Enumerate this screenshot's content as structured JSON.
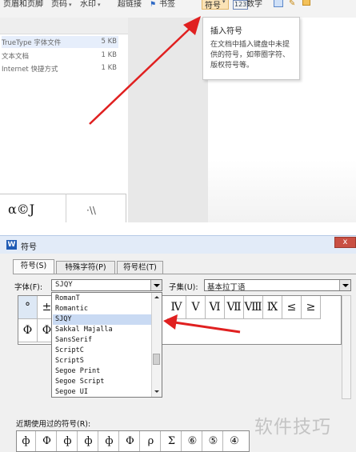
{
  "ribbon": {
    "items": [
      "页眉和页脚",
      "页码",
      "水印",
      "超链接",
      "书签"
    ],
    "symbol_button": "符号",
    "number_button": "数字"
  },
  "tooltip": {
    "title": "插入符号",
    "body": "在文档中插入键盘中未提供的符号，如带圈字符、版权符号等。"
  },
  "files": [
    {
      "name": "TrueType 字体文件",
      "size": "5 KB"
    },
    {
      "name": "文本文档",
      "size": "1 KB"
    },
    {
      "name": "Internet 快捷方式",
      "size": "1 KB"
    }
  ],
  "preview": {
    "glyph": "α©J",
    "glyph2": "·\\\\"
  },
  "dialog": {
    "title": "符号",
    "close": "x",
    "tabs": [
      "符号(S)",
      "特殊字符(P)",
      "符号栏(T)"
    ],
    "font_label": "字体(F):",
    "font_value": "SJQY",
    "subset_label": "子集(U):",
    "subset_value": "基本拉丁语",
    "font_options": [
      "RomanT",
      "Romantic",
      "SJQY",
      "Sakkal Majalla",
      "SansSerif",
      "ScriptC",
      "ScriptS",
      "Segoe Print",
      "Segoe Script",
      "Segoe UI"
    ],
    "selected_font": "SJQY",
    "grid_row1_visible": [
      "°",
      "±"
    ],
    "grid_row2_visible": [
      "Φ",
      "Φ"
    ],
    "grid_row1_right": [
      "Ⅳ",
      "Ⅴ",
      "Ⅵ",
      "Ⅶ",
      "Ⅷ",
      "Ⅸ",
      "≤",
      "≥"
    ],
    "recent_label": "近期使用过的符号(R):",
    "recent": [
      "ф",
      "Ф",
      "ф",
      "ф",
      "ф",
      "Φ",
      "ρ",
      "Σ",
      "⑥",
      "⑤",
      "④"
    ]
  },
  "watermark": "软件技巧",
  "colors": {
    "arrow": "#e02020",
    "accent": "#1f5bb5",
    "close": "#c94f43"
  }
}
